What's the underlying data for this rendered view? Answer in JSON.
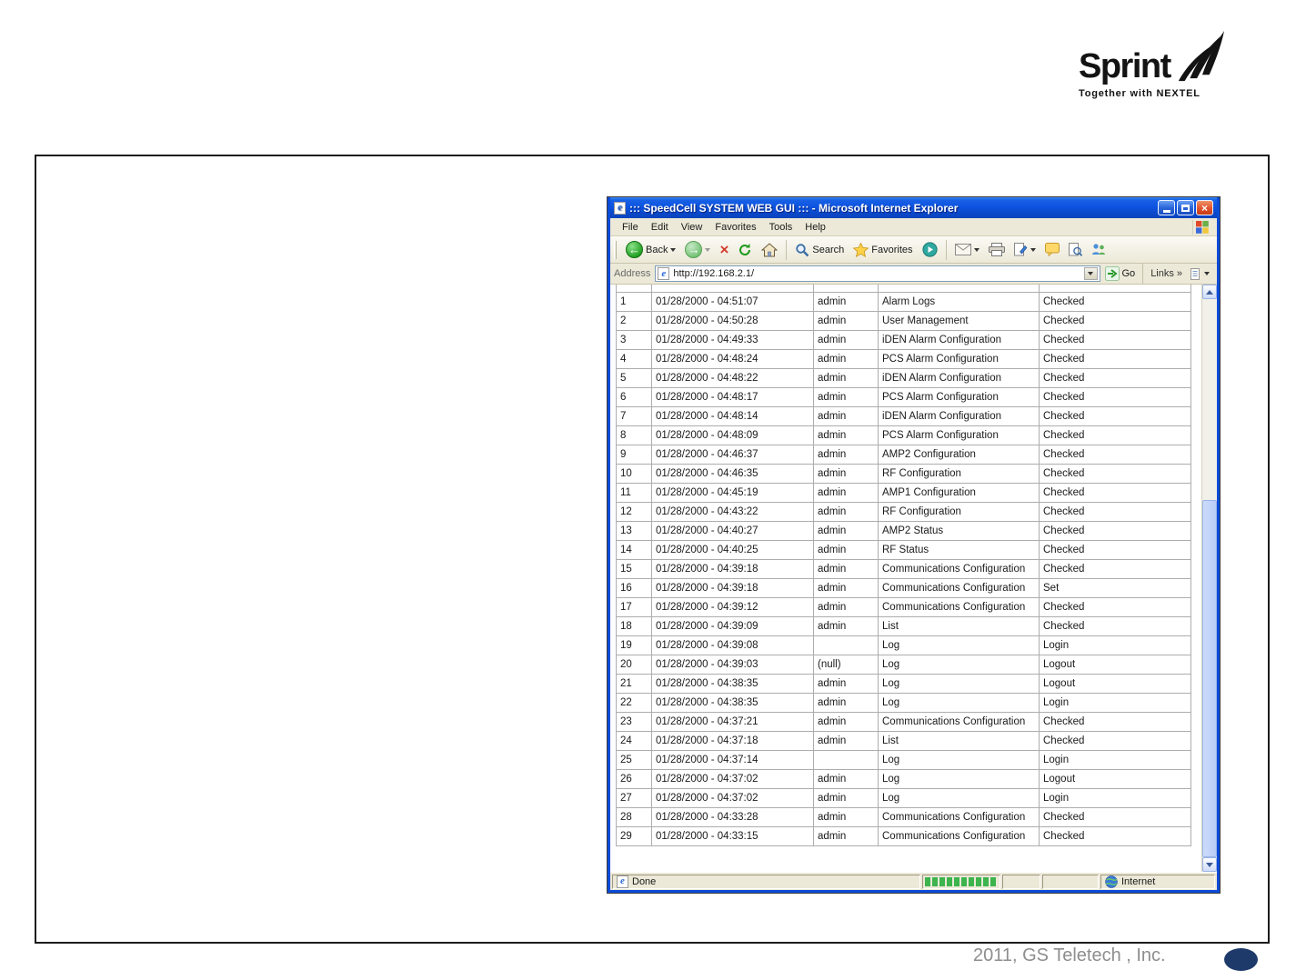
{
  "logo": {
    "brand": "Sprint",
    "tagline": "Together with NEXTEL"
  },
  "slide": {
    "footer_text": "2011, GS Teletech , Inc."
  },
  "colors": {
    "title_bar_blue": "#0d53e0",
    "progress_green": "#3db44e",
    "footer_ellipse_navy": "#1e3a6a"
  },
  "browser": {
    "title": "::: SpeedCell SYSTEM WEB GUI ::: - Microsoft Internet Explorer",
    "menu": [
      "File",
      "Edit",
      "View",
      "Favorites",
      "Tools",
      "Help"
    ],
    "toolbar": {
      "back": "Back",
      "search": "Search",
      "favorites": "Favorites"
    },
    "address": {
      "label": "Address",
      "url": "http://192.168.2.1/",
      "go": "Go",
      "links": "Links",
      "links_chevron": "»"
    },
    "status": {
      "left": "Done",
      "right": "Internet"
    }
  },
  "log_table": {
    "rows": [
      [
        "1",
        "01/28/2000 - 04:51:07",
        "admin",
        "Alarm Logs",
        "Checked"
      ],
      [
        "2",
        "01/28/2000 - 04:50:28",
        "admin",
        "User Management",
        "Checked"
      ],
      [
        "3",
        "01/28/2000 - 04:49:33",
        "admin",
        "iDEN Alarm Configuration",
        "Checked"
      ],
      [
        "4",
        "01/28/2000 - 04:48:24",
        "admin",
        "PCS Alarm Configuration",
        "Checked"
      ],
      [
        "5",
        "01/28/2000 - 04:48:22",
        "admin",
        "iDEN Alarm Configuration",
        "Checked"
      ],
      [
        "6",
        "01/28/2000 - 04:48:17",
        "admin",
        "PCS Alarm Configuration",
        "Checked"
      ],
      [
        "7",
        "01/28/2000 - 04:48:14",
        "admin",
        "iDEN Alarm Configuration",
        "Checked"
      ],
      [
        "8",
        "01/28/2000 - 04:48:09",
        "admin",
        "PCS Alarm Configuration",
        "Checked"
      ],
      [
        "9",
        "01/28/2000 - 04:46:37",
        "admin",
        "AMP2 Configuration",
        "Checked"
      ],
      [
        "10",
        "01/28/2000 - 04:46:35",
        "admin",
        "RF Configuration",
        "Checked"
      ],
      [
        "11",
        "01/28/2000 - 04:45:19",
        "admin",
        "AMP1 Configuration",
        "Checked"
      ],
      [
        "12",
        "01/28/2000 - 04:43:22",
        "admin",
        "RF Configuration",
        "Checked"
      ],
      [
        "13",
        "01/28/2000 - 04:40:27",
        "admin",
        "AMP2 Status",
        "Checked"
      ],
      [
        "14",
        "01/28/2000 - 04:40:25",
        "admin",
        "RF Status",
        "Checked"
      ],
      [
        "15",
        "01/28/2000 - 04:39:18",
        "admin",
        "Communications Configuration",
        "Checked"
      ],
      [
        "16",
        "01/28/2000 - 04:39:18",
        "admin",
        "Communications Configuration",
        "Set"
      ],
      [
        "17",
        "01/28/2000 - 04:39:12",
        "admin",
        "Communications Configuration",
        "Checked"
      ],
      [
        "18",
        "01/28/2000 - 04:39:09",
        "admin",
        "List",
        "Checked"
      ],
      [
        "19",
        "01/28/2000 - 04:39:08",
        "",
        "Log",
        "Login"
      ],
      [
        "20",
        "01/28/2000 - 04:39:03",
        "(null)",
        "Log",
        "Logout"
      ],
      [
        "21",
        "01/28/2000 - 04:38:35",
        "admin",
        "Log",
        "Logout"
      ],
      [
        "22",
        "01/28/2000 - 04:38:35",
        "admin",
        "Log",
        "Login"
      ],
      [
        "23",
        "01/28/2000 - 04:37:21",
        "admin",
        "Communications Configuration",
        "Checked"
      ],
      [
        "24",
        "01/28/2000 - 04:37:18",
        "admin",
        "List",
        "Checked"
      ],
      [
        "25",
        "01/28/2000 - 04:37:14",
        "",
        "Log",
        "Login"
      ],
      [
        "26",
        "01/28/2000 - 04:37:02",
        "admin",
        "Log",
        "Logout"
      ],
      [
        "27",
        "01/28/2000 - 04:37:02",
        "admin",
        "Log",
        "Login"
      ],
      [
        "28",
        "01/28/2000 - 04:33:28",
        "admin",
        "Communications Configuration",
        "Checked"
      ],
      [
        "29",
        "01/28/2000 - 04:33:15",
        "admin",
        "Communications Configuration",
        "Checked"
      ]
    ]
  }
}
